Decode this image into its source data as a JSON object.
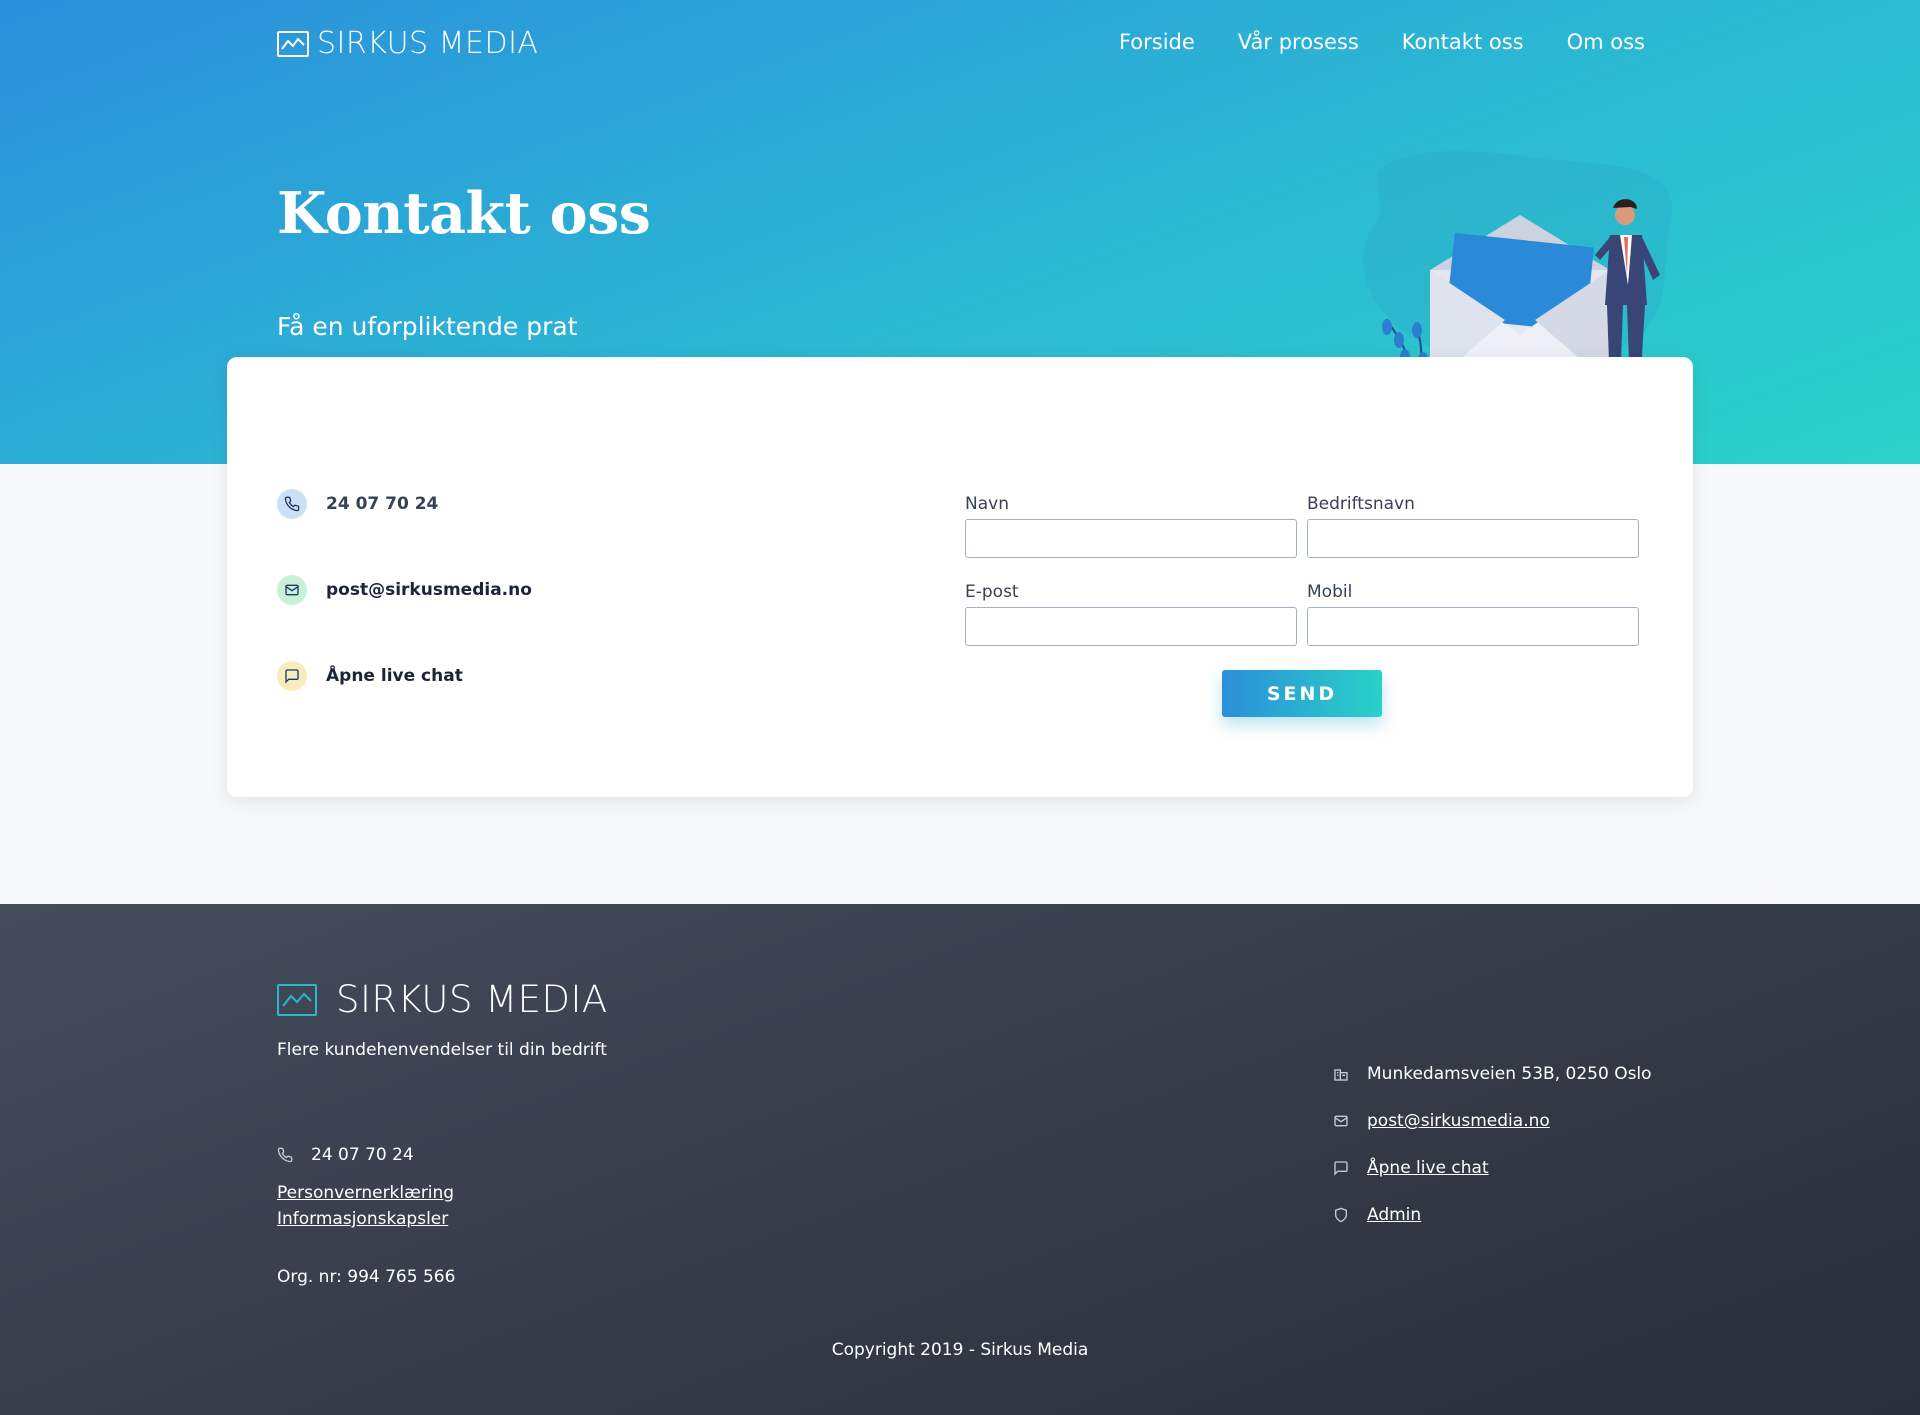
{
  "brand": {
    "name": "SIRKUS MEDIA",
    "logo_icon": "chart-line-icon"
  },
  "nav": {
    "items": [
      "Forside",
      "Vår prosess",
      "Kontakt oss",
      "Om oss"
    ]
  },
  "hero": {
    "title": "Kontakt oss",
    "subtitle": "Få en uforpliktende prat",
    "illustration": "man-with-envelope-illustration",
    "colors": {
      "gradient_start": "#2b8fdc",
      "gradient_end": "#2ad3c9"
    }
  },
  "contact": {
    "items": [
      {
        "icon": "phone-icon",
        "text": "24 07 70 24"
      },
      {
        "icon": "mail-icon",
        "text": "post@sirkusmedia.no"
      },
      {
        "icon": "chat-icon",
        "text": "Åpne live chat"
      }
    ]
  },
  "form": {
    "fields": [
      {
        "label": "Navn",
        "value": ""
      },
      {
        "label": "Bedriftsnavn",
        "value": ""
      },
      {
        "label": "E-post",
        "value": ""
      },
      {
        "label": "Mobil",
        "value": ""
      }
    ],
    "submit_label": "SEND"
  },
  "footer": {
    "brand": "SIRKUS MEDIA",
    "tagline": "Flere kundehenvendelser til din bedrift",
    "phone": "24 07 70 24",
    "links": [
      "Personvernerklæring",
      "Informasjonskapsler"
    ],
    "org": "Org. nr: 994 765 566",
    "right_items": [
      {
        "icon": "building-icon",
        "text": "Munkedamsveien 53B, 0250 Oslo",
        "link": false
      },
      {
        "icon": "mail-icon",
        "text": "post@sirkusmedia.no",
        "link": true
      },
      {
        "icon": "chat-icon",
        "text": "Åpne live chat",
        "link": true
      },
      {
        "icon": "shield-icon",
        "text": "Admin",
        "link": true
      }
    ],
    "copyright": "Copyright 2019 - Sirkus Media"
  },
  "colors": {
    "accent": "#2b9fd6",
    "footer_bg": "#3a404d",
    "text_dark": "#1d2435"
  }
}
